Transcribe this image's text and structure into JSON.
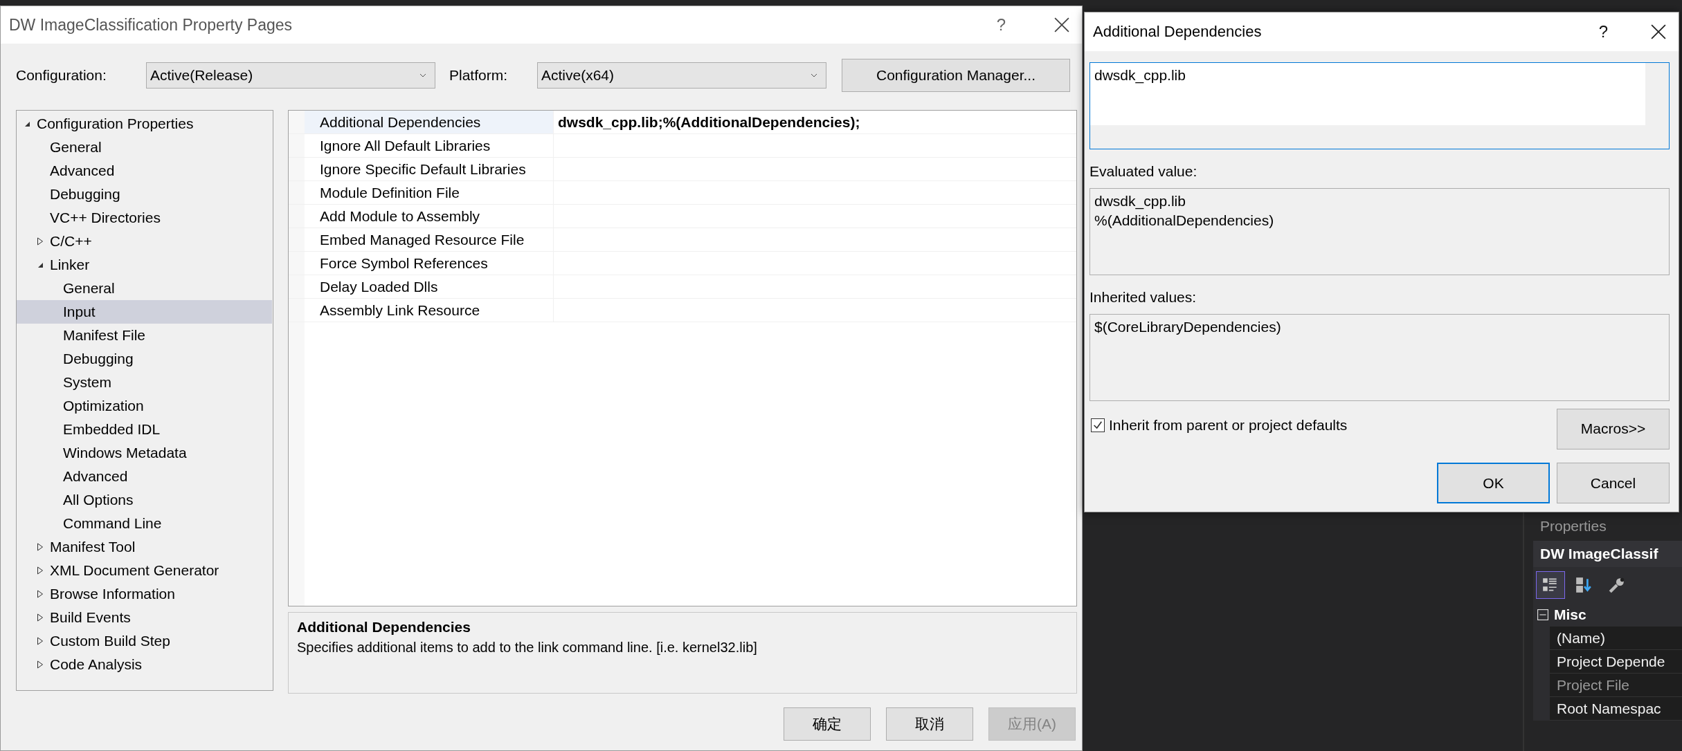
{
  "property_pages": {
    "title": "DW ImageClassification Property Pages",
    "help": "?",
    "configuration": {
      "label": "Configuration:",
      "value": "Active(Release)"
    },
    "platform": {
      "label": "Platform:",
      "value": "Active(x64)"
    },
    "manager_button": "Configuration Manager...",
    "tree": [
      {
        "label": "Configuration Properties",
        "expanded": true,
        "selected": false,
        "children": [
          {
            "label": "General",
            "selected": false
          },
          {
            "label": "Advanced",
            "selected": false
          },
          {
            "label": "Debugging",
            "selected": false
          },
          {
            "label": "VC++ Directories",
            "selected": false
          },
          {
            "label": "C/C++",
            "expanded": false,
            "selected": false
          },
          {
            "label": "Linker",
            "expanded": true,
            "selected": false,
            "children": [
              {
                "label": "General",
                "selected": false
              },
              {
                "label": "Input",
                "selected": true
              },
              {
                "label": "Manifest File",
                "selected": false
              },
              {
                "label": "Debugging",
                "selected": false
              },
              {
                "label": "System",
                "selected": false
              },
              {
                "label": "Optimization",
                "selected": false
              },
              {
                "label": "Embedded IDL",
                "selected": false
              },
              {
                "label": "Windows Metadata",
                "selected": false
              },
              {
                "label": "Advanced",
                "selected": false
              },
              {
                "label": "All Options",
                "selected": false
              },
              {
                "label": "Command Line",
                "selected": false
              }
            ]
          },
          {
            "label": "Manifest Tool",
            "expanded": false,
            "selected": false
          },
          {
            "label": "XML Document Generator",
            "expanded": false,
            "selected": false
          },
          {
            "label": "Browse Information",
            "expanded": false,
            "selected": false
          },
          {
            "label": "Build Events",
            "expanded": false,
            "selected": false
          },
          {
            "label": "Custom Build Step",
            "expanded": false,
            "selected": false
          },
          {
            "label": "Code Analysis",
            "expanded": false,
            "selected": false
          }
        ]
      }
    ],
    "properties": [
      {
        "name": "Additional Dependencies",
        "value": "dwsdk_cpp.lib;%(AdditionalDependencies);",
        "selected": true
      },
      {
        "name": "Ignore All Default Libraries",
        "selected": false
      },
      {
        "name": "Ignore Specific Default Libraries",
        "selected": false
      },
      {
        "name": "Module Definition File",
        "selected": false
      },
      {
        "name": "Add Module to Assembly",
        "selected": false
      },
      {
        "name": "Embed Managed Resource File",
        "selected": false
      },
      {
        "name": "Force Symbol References",
        "selected": false
      },
      {
        "name": "Delay Loaded Dlls",
        "selected": false
      },
      {
        "name": "Assembly Link Resource",
        "selected": false
      }
    ],
    "description": {
      "title": "Additional Dependencies",
      "text": "Specifies additional items to add to the link command line. [i.e. kernel32.lib]"
    },
    "buttons": [
      {
        "label": "确定",
        "disabled": false
      },
      {
        "label": "取消",
        "disabled": false
      },
      {
        "label": "应用(A)",
        "disabled": true
      }
    ]
  },
  "edit_dialog": {
    "title": "Additional Dependencies",
    "help": "?",
    "value": "dwsdk_cpp.lib",
    "evaluated_label": "Evaluated value:",
    "evaluated_lines": [
      "dwsdk_cpp.lib",
      "%(AdditionalDependencies)"
    ],
    "inherited_label": "Inherited values:",
    "inherited_lines": [
      "$(CoreLibraryDependencies)"
    ],
    "inherit": {
      "label": "Inherit from parent or project defaults",
      "checked": true
    },
    "macros_button": "Macros>>",
    "ok_button": "OK",
    "cancel_button": "Cancel"
  },
  "properties_panel": {
    "title": "Properties",
    "object": "DW ImageClassif",
    "toolbar": [
      {
        "kind": "categorized",
        "selected": true
      },
      {
        "kind": "alphabetical",
        "selected": false
      },
      {
        "kind": "pages",
        "selected": false
      }
    ],
    "group": {
      "name": "Misc",
      "expanded": true,
      "rows": [
        {
          "name": "(Name)",
          "disabled": false
        },
        {
          "name": "Project Depende",
          "disabled": false
        },
        {
          "name": "Project File",
          "disabled": true
        },
        {
          "name": "Root Namespac",
          "disabled": false
        }
      ]
    }
  }
}
